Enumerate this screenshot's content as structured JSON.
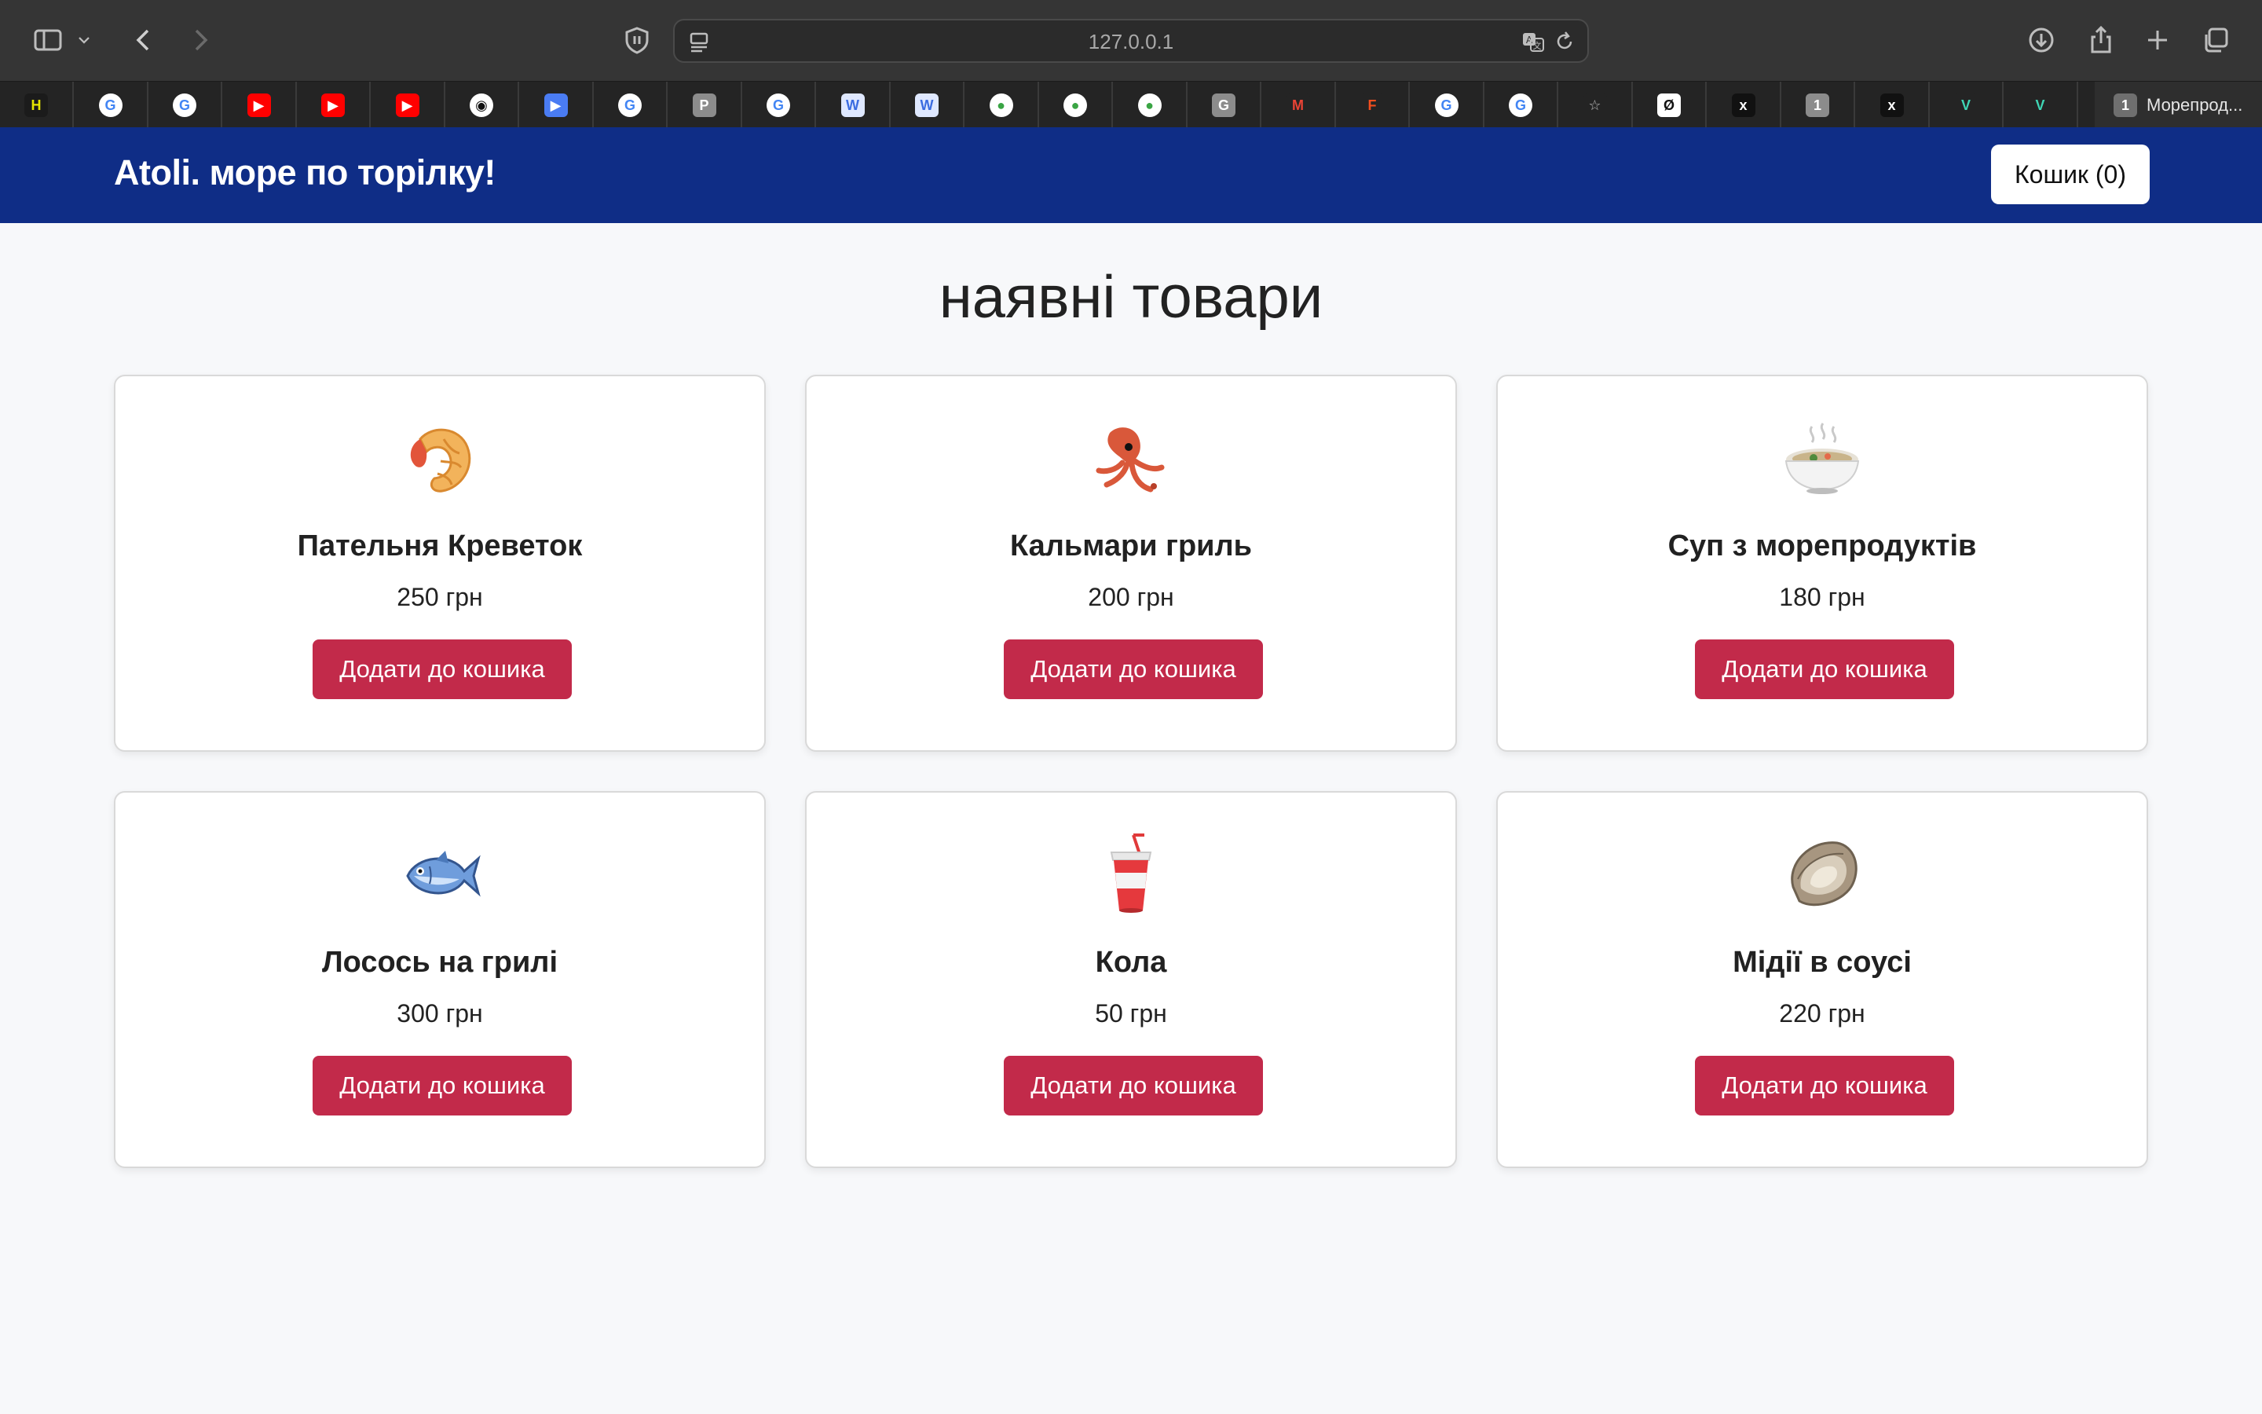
{
  "browser": {
    "url": "127.0.0.1",
    "active_tab": {
      "badge": "1",
      "title": "Морепрод..."
    },
    "tabs": [
      {
        "icon": "hornet-icon",
        "glyph": "H",
        "color": "#1b1b1b",
        "fg": "#e6e600"
      },
      {
        "icon": "google-icon",
        "glyph": "G",
        "color": "#ffffff",
        "fg": "#4285f4"
      },
      {
        "icon": "google-icon",
        "glyph": "G",
        "color": "#ffffff",
        "fg": "#4285f4"
      },
      {
        "icon": "youtube-icon",
        "glyph": "▶",
        "color": "#ff0000",
        "fg": "#ffffff"
      },
      {
        "icon": "youtube-icon",
        "glyph": "▶",
        "color": "#ff0000",
        "fg": "#ffffff"
      },
      {
        "icon": "youtube-icon",
        "glyph": "▶",
        "color": "#ff0000",
        "fg": "#ffffff"
      },
      {
        "icon": "github-icon",
        "glyph": "◉",
        "color": "#ffffff",
        "fg": "#111111"
      },
      {
        "icon": "play-store-icon",
        "glyph": "▶",
        "color": "#4a7cf3",
        "fg": "#ffffff"
      },
      {
        "icon": "google-icon",
        "glyph": "G",
        "color": "#ffffff",
        "fg": "#4285f4"
      },
      {
        "icon": "p-icon",
        "glyph": "P",
        "color": "#8c8c8c",
        "fg": "#ffffff"
      },
      {
        "icon": "google-icon",
        "glyph": "G",
        "color": "#ffffff",
        "fg": "#4285f4"
      },
      {
        "icon": "w-icon",
        "glyph": "W",
        "color": "#dfe8ff",
        "fg": "#3b6ce0"
      },
      {
        "icon": "w-icon",
        "glyph": "W",
        "color": "#dfe8ff",
        "fg": "#3b6ce0"
      },
      {
        "icon": "media-play-icon",
        "glyph": "●",
        "color": "#ffffff",
        "fg": "#3aa544"
      },
      {
        "icon": "media-play-icon",
        "glyph": "●",
        "color": "#ffffff",
        "fg": "#3aa544"
      },
      {
        "icon": "media-play-icon",
        "glyph": "●",
        "color": "#ffffff",
        "fg": "#3aa544"
      },
      {
        "icon": "g-gray-icon",
        "glyph": "G",
        "color": "#8c8c8c",
        "fg": "#ffffff"
      },
      {
        "icon": "gmail-icon",
        "glyph": "M",
        "color": "#242424",
        "fg": "#ea4335"
      },
      {
        "icon": "figma-icon",
        "glyph": "F",
        "color": "#242424",
        "fg": "#f24e1e"
      },
      {
        "icon": "google-icon",
        "glyph": "G",
        "color": "#ffffff",
        "fg": "#4285f4"
      },
      {
        "icon": "google-icon",
        "glyph": "G",
        "color": "#ffffff",
        "fg": "#4285f4"
      },
      {
        "icon": "star-icon",
        "glyph": "☆",
        "color": "#242424",
        "fg": "#bbbbbb"
      },
      {
        "icon": "null-icon",
        "glyph": "Ø",
        "color": "#ffffff",
        "fg": "#111111"
      },
      {
        "icon": "x-icon",
        "glyph": "x",
        "color": "#111111",
        "fg": "#ffffff"
      },
      {
        "icon": "one-icon",
        "glyph": "1",
        "color": "#8c8c8c",
        "fg": "#ffffff"
      },
      {
        "icon": "x-icon",
        "glyph": "x",
        "color": "#111111",
        "fg": "#ffffff"
      },
      {
        "icon": "v-icon",
        "glyph": "V",
        "color": "#242424",
        "fg": "#3fd6b5"
      },
      {
        "icon": "v-icon",
        "glyph": "V",
        "color": "#242424",
        "fg": "#3fd6b5"
      }
    ]
  },
  "site": {
    "brand": "Atoli. море по торілку!",
    "cart_label": "Кошик (0)",
    "page_title": "наявні товари",
    "add_label": "Додати до кошика"
  },
  "products": [
    {
      "name": "Пательня Креветок",
      "price": "250 грн",
      "icon": "shrimp-icon"
    },
    {
      "name": "Кальмари гриль",
      "price": "200 грн",
      "icon": "squid-icon"
    },
    {
      "name": "Суп з морепродуктів",
      "price": "180 грн",
      "icon": "soup-bowl-icon"
    },
    {
      "name": "Лосось на грилі",
      "price": "300 грн",
      "icon": "fish-icon"
    },
    {
      "name": "Кола",
      "price": "50 грн",
      "icon": "cola-cup-icon"
    },
    {
      "name": "Мідії в соусі",
      "price": "220 грн",
      "icon": "oyster-icon"
    }
  ],
  "colors": {
    "header_bg": "#0f2d86",
    "button_bg": "#c22a4a",
    "page_bg": "#f7f8fa"
  }
}
